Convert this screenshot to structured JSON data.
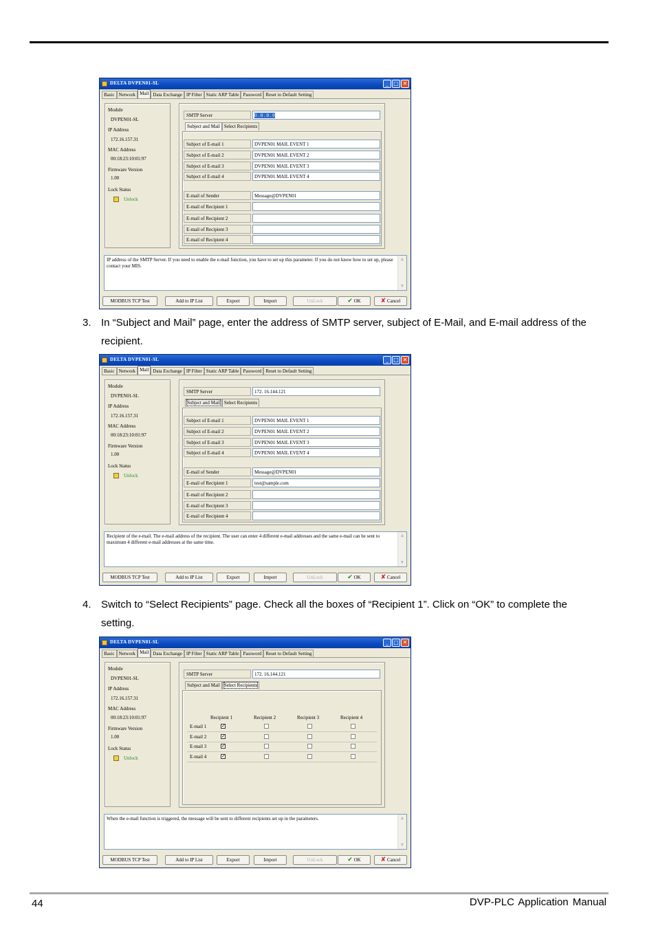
{
  "page": {
    "number": "44",
    "manual_title": "DVP-PLC  Application  Manual"
  },
  "steps": [
    {
      "num": "3.",
      "text": "In “Subject and Mail” page, enter the address of SMTP server, subject of E-Mail, and E-mail address of the recipient."
    },
    {
      "num": "4.",
      "text": "Switch to “Select Recipients” page. Check all the boxes of “Recipient 1”. Click on “OK” to complete the setting."
    }
  ],
  "window": {
    "title": "DELTA DVPEN01-SL",
    "tabs": [
      "Basic",
      "Network",
      "Mail",
      "Data Exchange",
      "IP Filter",
      "Static ARP Table",
      "Password",
      "Reset to Default Setting"
    ],
    "active_tab": "Mail",
    "left_panel": {
      "module_label": "Module",
      "module_value": "DVPEN01-SL",
      "ip_label": "IP Address",
      "ip_value": "172.16.157.31",
      "mac_label": "MAC Address",
      "mac_value": "00:18:23:10:01:97",
      "fw_label": "Firmware Version",
      "fw_value": "1.00",
      "lock_label": "Lock Status",
      "lock_value": "Unlock"
    },
    "smtp_label": "SMTP Server",
    "subtabs": [
      "Subject and Mail",
      "Select Recipients"
    ],
    "subject_labels": [
      "Subject of E-mail 1",
      "Subject of E-mail 2",
      "Subject of E-mail 3",
      "Subject of E-mail 4"
    ],
    "subject_values": [
      "DVPEN01 MAIL EVENT 1",
      "DVPEN01 MAIL EVENT 2",
      "DVPEN01 MAIL EVENT 3",
      "DVPEN01 MAIL EVENT 4"
    ],
    "sender_label": "E-mail of Sender",
    "sender_value": "Message@DVPEN01",
    "recipient_labels": [
      "E-mail of Recipient 1",
      "E-mail of Recipient 2",
      "E-mail of Recipient 3",
      "E-mail of Recipient 4"
    ],
    "buttons": {
      "modbus": "MODBUS TCP Test",
      "add_ip": "Add to IP List",
      "export": "Export",
      "import": "Import",
      "unlock": "UnLock",
      "ok": "OK",
      "cancel": "Cancel"
    },
    "grid": {
      "headers": [
        "Recipient 1",
        "Recipient 2",
        "Recipient 3",
        "Recipient 4"
      ],
      "rows": [
        "E-mail 1",
        "E-mail 2",
        "E-mail 3",
        "E-mail 4"
      ]
    }
  },
  "screens": [
    {
      "smtp_value": "0 . 0 . 0 . 0",
      "recipient_values": [
        "",
        "",
        "",
        ""
      ],
      "description": "IP address of the SMTP Server. If you need to enable the e-mail function, you have to set up this parameter. If you do not know how to set up, please contact your MIS."
    },
    {
      "smtp_value": "172. 16.144.121",
      "recipient_values": [
        "test@sample.com",
        "",
        "",
        ""
      ],
      "description": "Recipient of the e-mail. The e-mail address of the recipient. The user can enter 4 different e-mail addresses and the same e-mail can be sent to maximum 4 different e-mail addresses at the same time."
    },
    {
      "smtp_value": "172. 16.144.121",
      "checked": [
        [
          true,
          false,
          false,
          false
        ],
        [
          true,
          false,
          false,
          false
        ],
        [
          true,
          false,
          false,
          false
        ],
        [
          true,
          false,
          false,
          false
        ]
      ],
      "description": "When the e-mail function is triggered, the message will be sent to different recipients set up in the parameters."
    }
  ]
}
